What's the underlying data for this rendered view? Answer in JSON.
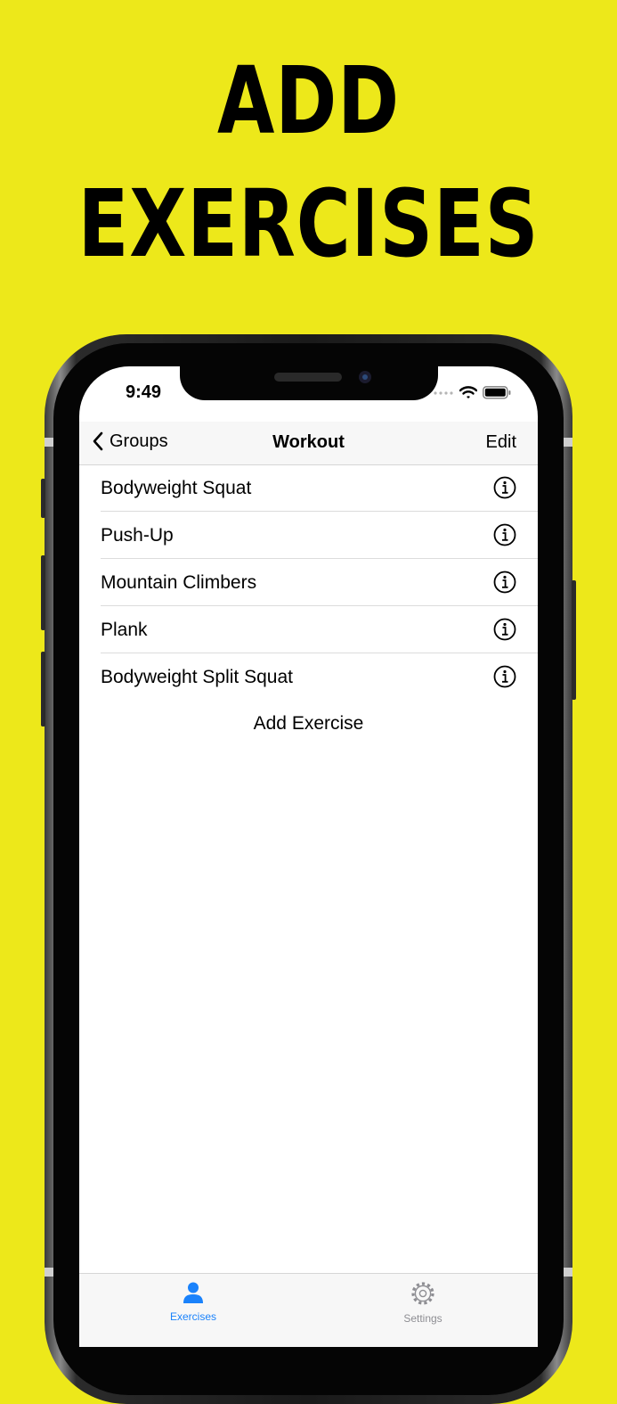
{
  "headline": {
    "line1": "ADD",
    "line2": "EXERCISES"
  },
  "status_bar": {
    "time": "9:49"
  },
  "nav": {
    "back_label": "Groups",
    "title": "Workout",
    "edit_label": "Edit"
  },
  "exercises": [
    {
      "name": "Bodyweight Squat"
    },
    {
      "name": "Push-Up"
    },
    {
      "name": "Mountain Climbers"
    },
    {
      "name": "Plank"
    },
    {
      "name": "Bodyweight Split Squat"
    }
  ],
  "add_exercise_label": "Add Exercise",
  "tabs": [
    {
      "label": "Exercises",
      "icon": "person-icon",
      "selected": true
    },
    {
      "label": "Settings",
      "icon": "gear-icon",
      "selected": false
    }
  ],
  "colors": {
    "background": "#EDE81A",
    "accent": "#1A82FB",
    "inactive_tab": "#8E8E93"
  }
}
